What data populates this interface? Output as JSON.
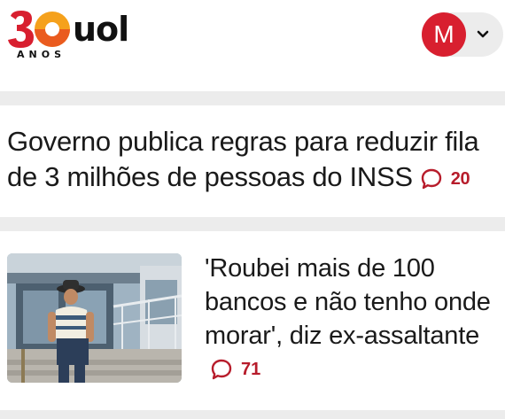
{
  "brand": {
    "logo_number": "30",
    "logo_name": "uol",
    "logo_tagline": "ANOS",
    "colors": {
      "red": "#d81f2f",
      "orange": "#f5a11c",
      "text": "#111111"
    }
  },
  "account": {
    "avatar_initial": "M",
    "avatar_color": "#d81f2f",
    "menu_icon": "chevron-down-icon"
  },
  "articles": [
    {
      "headline": "Governo publica regras para reduzir fila de 3 milhões de pessoas do INSS",
      "comments": "20",
      "comment_icon": "comment-bubble-icon"
    },
    {
      "headline": "'Roubei mais de 100 bancos e não tenho onde morar', diz ex-assaltante",
      "comments": "71",
      "comment_icon": "comment-bubble-icon",
      "thumbnail": "photo-man-in-hat-outside-building"
    }
  ],
  "accent_color": "#b71c2b"
}
